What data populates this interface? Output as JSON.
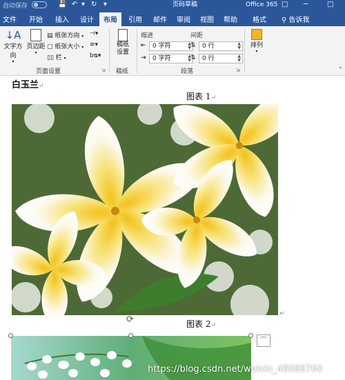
{
  "titlebar": {
    "autosave_label": "自动保存",
    "title": "页码草稿",
    "office_label": "Office 365",
    "minimize_glyph": "─",
    "restore_glyph": "□"
  },
  "tabs": [
    {
      "label": "文件"
    },
    {
      "label": "开始"
    },
    {
      "label": "插入"
    },
    {
      "label": "设计"
    },
    {
      "label": "布局",
      "active": true
    },
    {
      "label": "引用"
    },
    {
      "label": "邮件"
    },
    {
      "label": "审阅"
    },
    {
      "label": "视图"
    },
    {
      "label": "帮助"
    },
    {
      "label": "格式"
    }
  ],
  "search": {
    "label": "告诉我"
  },
  "ribbon": {
    "page_setup": {
      "text_direction": "文字方向",
      "margins": "页边距",
      "orientation": "纸张方向",
      "size": "纸张大小",
      "columns": "栏",
      "label": "页面设置"
    },
    "draft": {
      "label_big": "稿纸设置",
      "label": "稿纸"
    },
    "paragraph": {
      "indent_label": "缩进",
      "spacing_label": "间距",
      "indent_left": "0 字符",
      "indent_right": "0 字符",
      "space_before": "0 行",
      "space_after": "0 行",
      "label": "段落"
    },
    "arrange": {
      "label": "排列"
    }
  },
  "document": {
    "heading": "白玉兰",
    "caption1_label": "图表",
    "caption1_num": "1",
    "caption2_label": "图表",
    "caption2_num": "2",
    "paragraph_mark": "↵"
  },
  "watermark": "https://blog.csdn.net/weixin_48988760",
  "colors": {
    "accent": "#2b579a",
    "ribbon_bg": "#f3f3f3"
  }
}
